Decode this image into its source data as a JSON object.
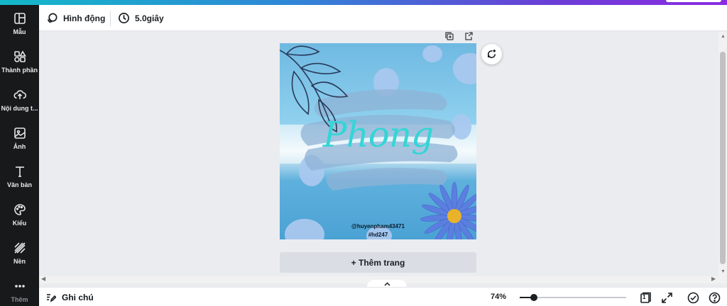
{
  "sidebar": {
    "items": [
      {
        "label": "Mẫu",
        "icon": "layout-icon"
      },
      {
        "label": "Thành phần",
        "icon": "shapes-icon"
      },
      {
        "label": "Nội dung t...",
        "icon": "upload-icon"
      },
      {
        "label": "Ảnh",
        "icon": "image-icon"
      },
      {
        "label": "Văn bản",
        "icon": "text-icon"
      },
      {
        "label": "Kiểu",
        "icon": "palette-icon"
      },
      {
        "label": "Nền",
        "icon": "pattern-icon"
      },
      {
        "label": "Thêm",
        "icon": "more-icon"
      }
    ]
  },
  "toolbar": {
    "animate_label": "Hình động",
    "duration_label": "5.0giây"
  },
  "design": {
    "title_text": "Phong",
    "handle_text": "@huyenpham43471",
    "tag_text": "#hd247"
  },
  "add_page_label": "+ Thêm trang",
  "bottom": {
    "notes_label": "Ghi chú",
    "zoom_label": "74%",
    "zoom_level_percent": 74,
    "page_count": "1"
  },
  "colors": {
    "sidebar_bg": "#18191b",
    "canvas_bg": "#ebecf0",
    "title_color": "#35d5d6"
  }
}
